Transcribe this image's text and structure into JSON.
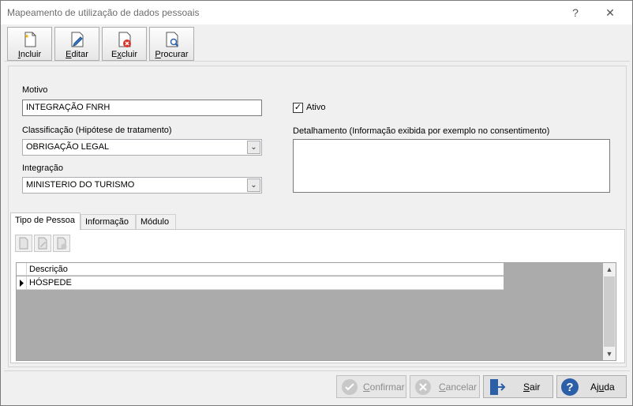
{
  "window": {
    "title": "Mapeamento de utilização de dados pessoais",
    "help": "?",
    "close": "✕"
  },
  "toolbar": {
    "incluir": {
      "label": "Incluir",
      "accel": "I",
      "rest": "ncluir"
    },
    "editar": {
      "label": "Editar",
      "accel": "E",
      "rest": "ditar"
    },
    "excluir": {
      "label": "Excluir",
      "accel": "x",
      "pre": "E",
      "rest": "cluir"
    },
    "procurar": {
      "label": "Procurar",
      "accel": "P",
      "rest": "rocurar"
    }
  },
  "form": {
    "motivo_label": "Motivo",
    "motivo_value": "INTEGRAÇÃO FNRH",
    "classificacao_label": "Classificação (Hipótese de tratamento)",
    "classificacao_value": "OBRIGAÇÃO LEGAL",
    "integracao_label": "Integração",
    "integracao_value": "MINISTERIO DO TURISMO",
    "ativo_label": "Ativo",
    "ativo_checked": true,
    "detalhamento_label": "Detalhamento (Informação exibida por exemplo no consentimento)",
    "detalhamento_value": ""
  },
  "tabs": [
    {
      "label": "Tipo de Pessoa",
      "active": true
    },
    {
      "label": "Informação",
      "active": false
    },
    {
      "label": "Módulo",
      "active": false
    }
  ],
  "grid": {
    "columns": [
      "Descrição"
    ],
    "rows": [
      [
        "HÓSPEDE"
      ]
    ]
  },
  "buttons": {
    "confirmar": {
      "pre": "",
      "accel": "C",
      "rest": "onfirmar",
      "disabled": true
    },
    "cancelar": {
      "pre": "",
      "accel": "C",
      "rest": "ancelar",
      "disabled": true
    },
    "sair": {
      "pre": "",
      "accel": "S",
      "rest": "air",
      "disabled": false
    },
    "ajuda": {
      "pre": "Aj",
      "accel": "u",
      "rest": "da",
      "disabled": false
    }
  },
  "colors": {
    "accent": "#2b5fa8",
    "disabled_text": "#8c8c8c"
  }
}
